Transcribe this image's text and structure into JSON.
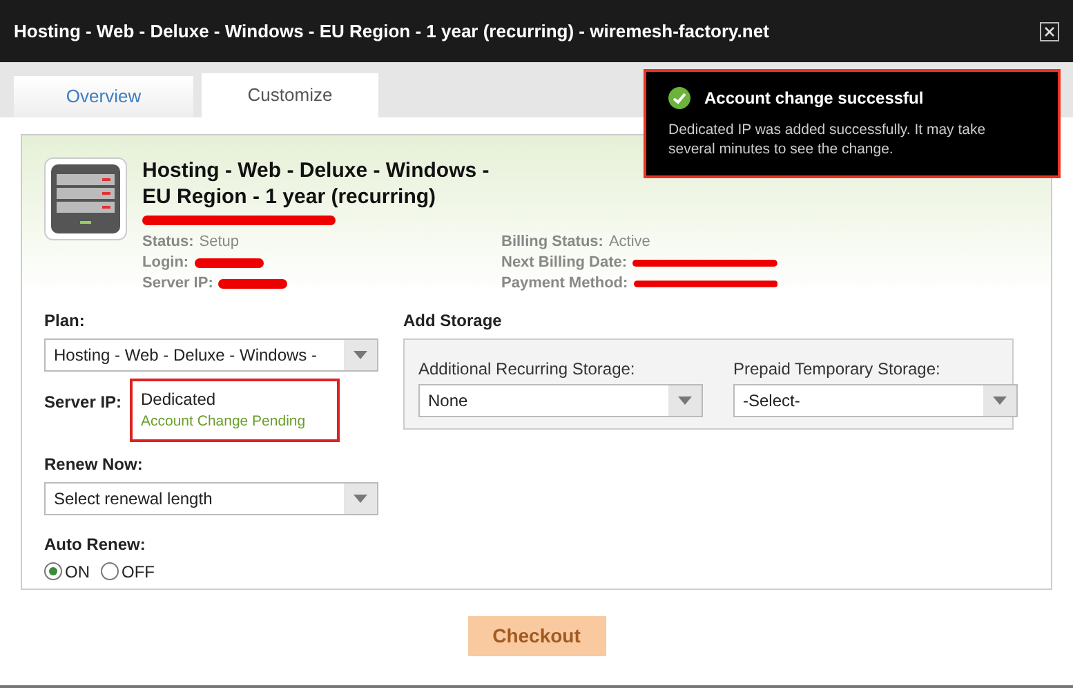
{
  "window": {
    "title": "Hosting - Web - Deluxe - Windows - EU Region - 1 year (recurring) - wiremesh-factory.net"
  },
  "tabs": [
    {
      "label": "Overview",
      "selected": false
    },
    {
      "label": "Customize",
      "selected": true
    }
  ],
  "toast": {
    "title": "Account change successful",
    "message": "Dedicated IP was added successfully. It may take several minutes to see the change.",
    "highlighted": true
  },
  "product": {
    "name": "Hosting - Web - Deluxe - Windows - EU Region - 1 year (recurring)",
    "domain_redacted": true,
    "info": [
      {
        "label": "Status:",
        "value": "Setup",
        "redacted": false
      },
      {
        "label": "Billing Status:",
        "value": "Active",
        "redacted": false
      },
      {
        "label": "Login:",
        "redacted": true
      },
      {
        "label": "Next Billing Date:",
        "redacted": true
      },
      {
        "label": "Server IP:",
        "redacted": true
      },
      {
        "label": "Payment Method:",
        "redacted": true
      }
    ]
  },
  "plan": {
    "label": "Plan:",
    "value": "Hosting - Web - Deluxe - Windows -"
  },
  "server_ip": {
    "label": "Server IP:",
    "value": "Dedicated",
    "note": "Account Change Pending",
    "highlighted": true
  },
  "renew_now": {
    "label": "Renew Now:",
    "value": "Select renewal length"
  },
  "auto_renew": {
    "label": "Auto Renew:",
    "options": [
      {
        "label": "ON",
        "selected": true
      },
      {
        "label": "OFF",
        "selected": false
      }
    ]
  },
  "storage": {
    "title": "Add Storage",
    "fields": [
      {
        "label": "Additional Recurring Storage:",
        "value": "None"
      },
      {
        "label": "Prepaid Temporary Storage:",
        "value": "-Select-"
      }
    ]
  },
  "checkout": {
    "label": "Checkout",
    "disabled": true
  }
}
